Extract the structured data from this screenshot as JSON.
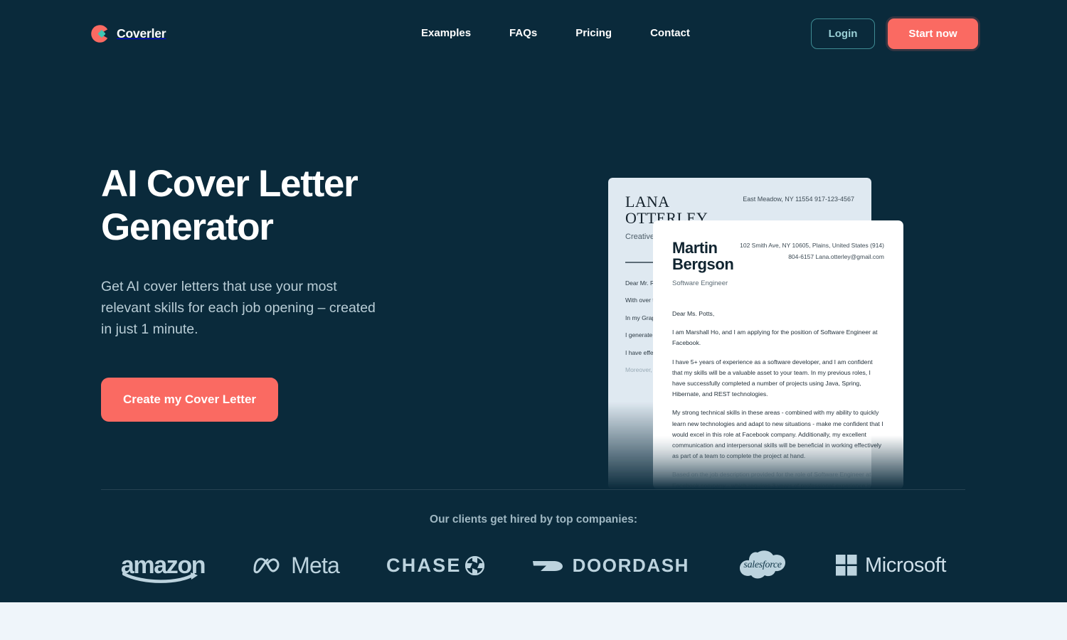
{
  "theme": {
    "bg_dark": "#0a2a3b",
    "accent_coral": "#fa6a62",
    "accent_teal": "#3fc6b4",
    "bottom_section": "#eff5fa"
  },
  "header": {
    "brand": "Coverler",
    "nav": [
      {
        "label": "Examples"
      },
      {
        "label": "FAQs"
      },
      {
        "label": "Pricing"
      },
      {
        "label": "Contact"
      }
    ],
    "login_label": "Login",
    "start_label": "Start now"
  },
  "hero": {
    "headline": "AI Cover Letter\nGenerator",
    "subhead": "Get AI cover letters that use your most relevant skills for each job opening – created in just 1 minute.",
    "cta_label": "Create my Cover Letter"
  },
  "letter_back": {
    "name": "LANA\nOTTERLEY",
    "role": "Creative Director",
    "contact": "East Meadow, NY 11554\n917-123-4567",
    "paragraphs": [
      "Dear Mr. R",
      "With over \nto reach o\nteam.",
      "In my Grap\nvery simila\nlearn, I kno\nasset to yo",
      "I generate\ntraditional\nelements t",
      "I have effe\nchallengin\nPhotoshop\nknowledge"
    ],
    "faded_paragraph": "Moreover,\nme to be a"
  },
  "letter_front": {
    "name": "Martin\nBergson",
    "role": "Software Engineer",
    "contact": "102 Smith Ave, NY 10605,\nPlains, United States\n(914) 804-6157\nLana.otterley@gmail.com",
    "salutation": "Dear Ms. Potts,",
    "paragraphs": [
      "I am Marshall Ho, and I am applying for the position of Software Engineer at Facebook.",
      "I have 5+ years of experience as a software developer, and I am confident that my skills will be a valuable asset to your team. In my previous roles, I have successfully completed a number of projects using Java, Spring, Hibernate, and REST technologies.",
      "My strong technical skills in these areas - combined with my ability to quickly learn new technologies and adapt to new situations - make me confident that I would excel in this role at Facebook company. Additionally, my excellent communication and interpersonal skills will be beneficial in working effectively as part of a team to complete the project at hand."
    ],
    "faded_paragraph": "Based on the job description provided for the role of Software Engineer at Facebook company - which requires 3 years of professional experience in"
  },
  "clients": {
    "label": "Our clients get hired by top companies:",
    "logos": [
      {
        "name": "amazon",
        "text": "amazon"
      },
      {
        "name": "meta",
        "text": "Meta"
      },
      {
        "name": "chase",
        "text": "CHASE"
      },
      {
        "name": "doordash",
        "text": "DOORDASH"
      },
      {
        "name": "salesforce",
        "text": "salesforce"
      },
      {
        "name": "microsoft",
        "text": "Microsoft"
      }
    ]
  }
}
